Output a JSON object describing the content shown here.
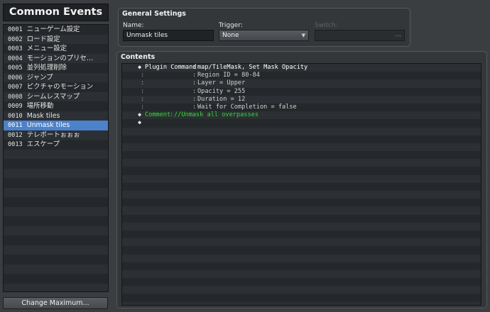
{
  "sidebar": {
    "title": "Common Events",
    "events": [
      {
        "num": "0001",
        "name": "ニューゲーム設定"
      },
      {
        "num": "0002",
        "name": "ロード設定"
      },
      {
        "num": "0003",
        "name": "メニュー設定"
      },
      {
        "num": "0004",
        "name": "モーションのプリセ…"
      },
      {
        "num": "0005",
        "name": "並列処理削除"
      },
      {
        "num": "0006",
        "name": "ジャンプ"
      },
      {
        "num": "0007",
        "name": "ピクチャのモーション"
      },
      {
        "num": "0008",
        "name": "シームレスマップ"
      },
      {
        "num": "0009",
        "name": "場所移動"
      },
      {
        "num": "0010",
        "name": "Mask tiles"
      },
      {
        "num": "0011",
        "name": "Unmask tiles"
      },
      {
        "num": "0012",
        "name": "テレポートぉぉぉ"
      },
      {
        "num": "0013",
        "name": "エスケープ"
      }
    ],
    "selected_index": 10,
    "change_max_label": "Change Maximum..."
  },
  "general_settings": {
    "title": "General Settings",
    "name_label": "Name:",
    "name_value": "Unmask tiles",
    "trigger_label": "Trigger:",
    "trigger_value": "None",
    "switch_label": "Switch:",
    "switch_value": "",
    "switch_button": "..."
  },
  "contents": {
    "title": "Contents",
    "commands": [
      {
        "type": "head",
        "marker": "◆",
        "label": "Plugin Command",
        "sep": ":",
        "value": "map/TileMask, Set Mask Opacity"
      },
      {
        "type": "param",
        "marker": ":",
        "sep": ":",
        "value": "Region ID = 80-84"
      },
      {
        "type": "param",
        "marker": ":",
        "sep": ":",
        "value": "Layer = Upper"
      },
      {
        "type": "param",
        "marker": ":",
        "sep": ":",
        "value": "Opacity = 255"
      },
      {
        "type": "param",
        "marker": ":",
        "sep": ":",
        "value": "Duration = 12"
      },
      {
        "type": "param",
        "marker": ":",
        "sep": ":",
        "value": "Wait for Completion = false"
      },
      {
        "type": "comment",
        "marker": "◆",
        "label": "Comment",
        "sep": ":",
        "value": "//Unmask all overpasses"
      },
      {
        "type": "empty",
        "marker": "◆"
      }
    ]
  },
  "colors": {
    "selection": "#4c82c9",
    "comment": "#2ede2e",
    "background": "#3b3e41"
  }
}
